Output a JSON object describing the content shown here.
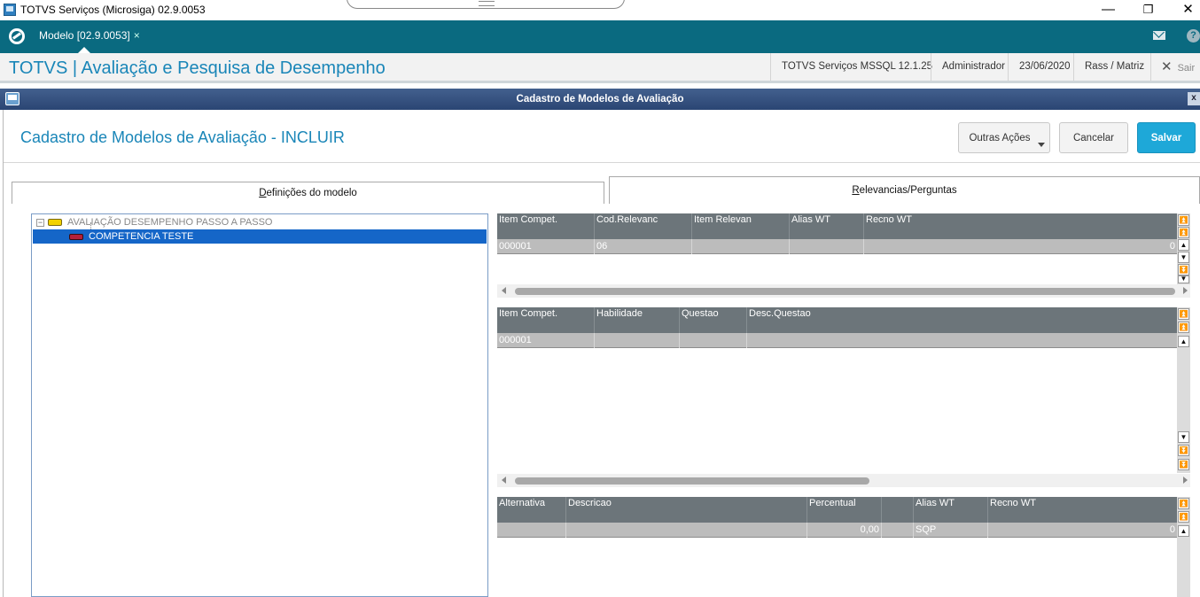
{
  "window": {
    "title": "TOTVS Serviços (Microsiga) 02.9.0053",
    "minimize": "—",
    "restore": "❐",
    "close": "✕"
  },
  "tabbar": {
    "tab_label": "Modelo [02.9.0053]",
    "tab_close": "×",
    "help": "?"
  },
  "app_header": {
    "title": "TOTVS | Avaliação e Pesquisa de Desempenho",
    "environment": "TOTVS Serviços MSSQL 12.1.25",
    "user": "Administrador",
    "date": "23/06/2020",
    "branch": "Rass / Matriz",
    "exit_label": "Sair",
    "exit_icon": "✕"
  },
  "dialog": {
    "title": "Cadastro de Modelos de Avaliação",
    "close": "x"
  },
  "page": {
    "title": "Cadastro de Modelos de Avaliação - INCLUIR",
    "actions": {
      "other_label": "Outras Ações",
      "cancel_label": "Cancelar",
      "save_label": "Salvar"
    }
  },
  "tabs": {
    "tab1_underlined": "D",
    "tab1_rest": "efinições do modelo",
    "tab2_underlined": "R",
    "tab2_rest": "elevancias/Perguntas"
  },
  "tree": {
    "root_expander": "−",
    "root_label": "AVALIAÇÃO DESEMPENHO PASSO A PASSO",
    "child_label": "COMPETENCIA TESTE"
  },
  "grid1": {
    "headers": [
      "Item Compet.",
      "Cod.Relevanc",
      "Item Relevan",
      "Alias WT",
      "Recno WT"
    ],
    "row": [
      "000001",
      "06",
      "",
      "",
      "0"
    ]
  },
  "grid2": {
    "headers": [
      "Item Compet.",
      "Habilidade",
      "Questao",
      "Desc.Questao"
    ],
    "row": [
      "000001",
      "",
      "",
      ""
    ]
  },
  "grid3": {
    "headers": [
      "Alternativa",
      "Descricao",
      "Percentual",
      "",
      "Alias WT",
      "Recno WT"
    ],
    "row": [
      "",
      "",
      "0,00",
      "",
      "SQP",
      "0"
    ]
  },
  "icons": {
    "scroll_top": "⏫",
    "scroll_up": "▲",
    "scroll_down": "▼",
    "scroll_bottom": "⏬"
  }
}
